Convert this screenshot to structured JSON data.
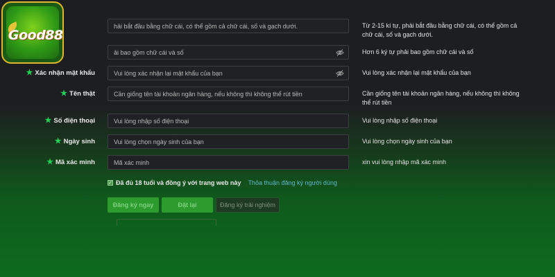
{
  "logo": {
    "text": "Good88"
  },
  "form": {
    "username": {
      "placeholder": "hải bắt đầu bằng chữ cái, có thể  gồm cả chữ cái, số và gạch dưới.",
      "hint": "Từ 2-15 kí tự, phải bắt đầu bằng chữ cái, có thể  gồm cả chữ cái, số và gạch dưới."
    },
    "password": {
      "placeholder": "ải bao gồm chữ cái và số",
      "hint": "Hơn 6 ký tự phải bao gồm chữ cái và số"
    },
    "confirm_password": {
      "label": "Xác nhận mật khẩu",
      "placeholder": "Vui lòng xác nhận lại mật khẩu của bạn",
      "hint": "Vui lòng xác nhận lại mật khẩu của bạn"
    },
    "real_name": {
      "label": "Tên thật",
      "placeholder": "Cần giống tên tài khoản ngân hàng, nếu không thì không thể rút tiền",
      "hint": "Cần giống tên tài khoản ngân hàng, nếu không thì không thể rút tiền"
    },
    "phone": {
      "label": "Số điện thoại",
      "placeholder": "Vui lòng nhập số điện thoại",
      "hint": "Vui lòng nhập số điện thoại"
    },
    "birthday": {
      "label": "Ngày sinh",
      "placeholder": "Vui lòng chọn ngày sinh của bạn",
      "hint": "Vui lòng chọn ngày sinh của bạn"
    },
    "captcha": {
      "label": "Mã xác minh",
      "placeholder": "Mã xác minh",
      "hint": "xin vui lòng nhập mã xác minh"
    },
    "agree": {
      "text": "Đã đủ 18 tuổi và đồng ý với trang web này",
      "link": "Thỏa thuận đăng ký người dùng",
      "checked": true
    },
    "buttons": {
      "register": "Đăng ký ngay",
      "reset": "Đặt lại",
      "trial": "Đăng ký trải nghiệm"
    }
  },
  "icons": {
    "eye": "eye-off-icon",
    "star": "required-star-icon",
    "check": "checkbox-check-icon"
  },
  "colors": {
    "accent": "#2e9b2e",
    "star": "#22d05a",
    "link": "#5fb7c9"
  }
}
